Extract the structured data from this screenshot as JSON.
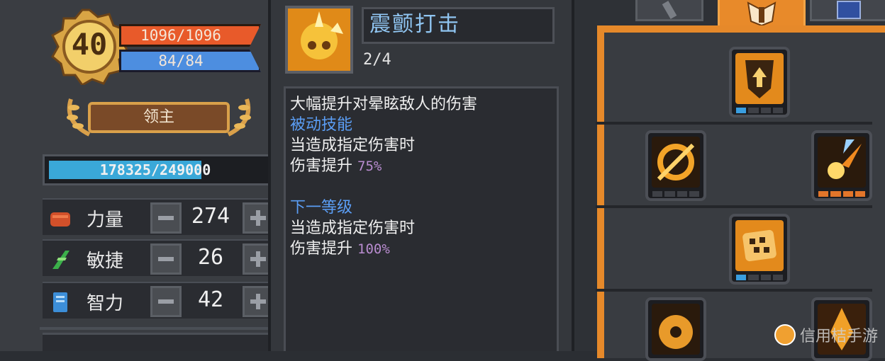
{
  "character": {
    "level": "40",
    "hp": "1096/1096",
    "mp": "84/84",
    "title": "领主",
    "exp": "178325/249000",
    "exp_fraction": 0.716,
    "stats": [
      {
        "name": "力量",
        "value": "274",
        "icon": "fist-icon"
      },
      {
        "name": "敏捷",
        "value": "26",
        "icon": "green-feather-icon"
      },
      {
        "name": "智力",
        "value": "42",
        "icon": "blue-book-icon"
      }
    ]
  },
  "skill": {
    "name": "震颤打击",
    "level": "2/4",
    "description": "大幅提升对晕眩敌人的伤害",
    "type": "被动技能",
    "current": {
      "condition": "当造成指定伤害时",
      "effect_label": "伤害提升",
      "effect_value": "75%"
    },
    "next_label": "下一等级",
    "next": {
      "condition": "当造成指定伤害时",
      "effect_label": "伤害提升",
      "effect_value": "100%"
    }
  },
  "skill_tree": {
    "accent_color": "#e6892a",
    "nodes": [
      {
        "name": "shield-arrow-skill-icon",
        "pips": [
          "on",
          "off",
          "off",
          "off"
        ]
      },
      {
        "name": "crescent-strike-skill-icon",
        "pips": [
          "off",
          "off",
          "off",
          "off"
        ]
      },
      {
        "name": "flaming-meteor-skill-icon",
        "pips": [
          "or",
          "or",
          "or",
          "or"
        ]
      },
      {
        "name": "tremor-strike-skill-icon",
        "pips": [
          "on",
          "off",
          "off",
          "off"
        ]
      },
      {
        "name": "sawblade-skill-icon",
        "pips": []
      },
      {
        "name": "fire-aura-skill-icon",
        "pips": []
      }
    ]
  },
  "watermark": {
    "text": "信用桔手游"
  }
}
